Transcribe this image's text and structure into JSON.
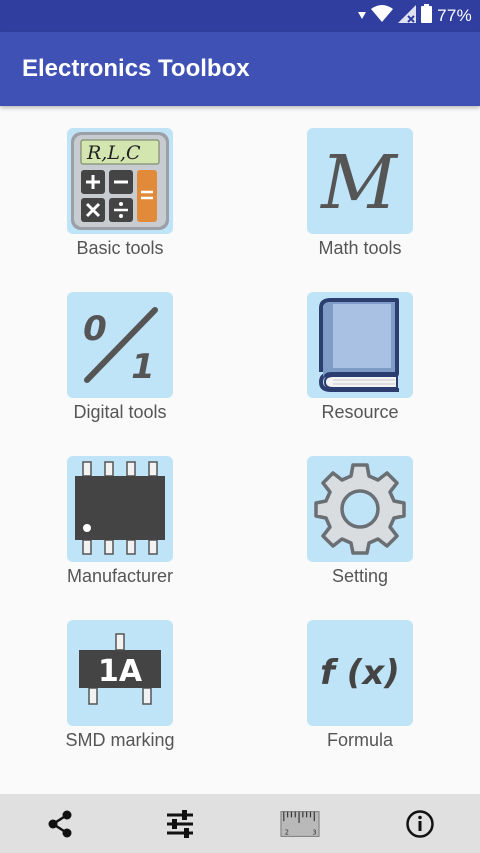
{
  "status_bar": {
    "battery_percent": "77%",
    "icons": [
      "signal-down-icon",
      "wifi-icon",
      "cellular-no-data-icon",
      "battery-icon"
    ]
  },
  "app_bar": {
    "title": "Electronics Toolbox"
  },
  "tools": [
    {
      "label": "Basic tools",
      "icon": "calculator-icon",
      "calc_display": "R,L,C"
    },
    {
      "label": "Math tools",
      "icon": "math-m-icon",
      "glyph": "M"
    },
    {
      "label": "Digital tools",
      "icon": "digital-01-icon",
      "glyph_top": "0",
      "glyph_bottom": "1"
    },
    {
      "label": "Resource",
      "icon": "book-icon"
    },
    {
      "label": "Manufacturer",
      "icon": "ic-chip-icon"
    },
    {
      "label": "Setting",
      "icon": "gear-icon"
    },
    {
      "label": "SMD marking",
      "icon": "smd-component-icon",
      "marking": "1A"
    },
    {
      "label": "Formula",
      "icon": "formula-fx-icon",
      "glyph": "f (x)"
    }
  ],
  "bottom_bar": {
    "icons": [
      "share-icon",
      "sliders-icon",
      "ruler-icon",
      "info-icon"
    ],
    "ruler_marks": [
      "2",
      "3"
    ]
  },
  "colors": {
    "status_bar": "#303f9f",
    "app_bar": "#3f51b5",
    "tile_background": "#bfe3f7",
    "bottom_bar": "#e0e0e0"
  }
}
